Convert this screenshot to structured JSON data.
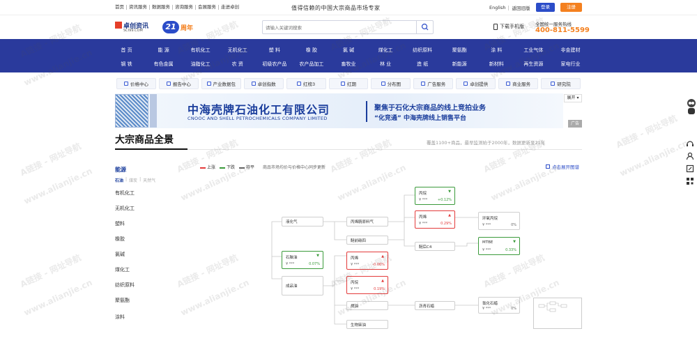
{
  "topbar": {
    "links": [
      "首页",
      "资讯服务",
      "数据服务",
      "咨询服务",
      "会展服务",
      "走进卓创"
    ],
    "slogan": "值得信赖的中国大宗商品市场专家",
    "english": "English",
    "old_version": "返回旧版",
    "login": "登录",
    "register": "注册"
  },
  "header": {
    "logo_main": "卓创资讯",
    "logo_sub": "SCI99.COM",
    "anniv_number": "21",
    "anniv_text": "周年",
    "search_placeholder": "请输入关键词搜索",
    "mobile": "下载手机版",
    "hotline_label": "全国统一服务热线",
    "hotline_number": "400-811-5599"
  },
  "nav": {
    "row1": [
      "首 页",
      "能 源",
      "有机化工",
      "无机化工",
      "塑 料",
      "橡 胶",
      "氯 碱",
      "煤化工",
      "纺织原料",
      "聚氨酯",
      "涂 料",
      "工业气体",
      "非金建材"
    ],
    "row2": [
      "钢 铁",
      "有色金属",
      "油脂化工",
      "农 资",
      "初级农产品",
      "农产品加工",
      "畜牧业",
      "林 业",
      "造 纸",
      "新能源",
      "新材料",
      "再生资源",
      "家电行业"
    ]
  },
  "subnav": [
    "价格中心",
    "报告中心",
    "产业数据包",
    "卓创指数",
    "红榜3",
    "红期",
    "分布图",
    "广告服务",
    "卓创提供",
    "商业服务",
    "研究院"
  ],
  "banner": {
    "company_cn": "中海壳牌石油化工有限公司",
    "company_en": "CNOOC AND SHELL PETROCHEMICALS COMPANY LIMITED",
    "line1": "聚焦于石化大宗商品的线上竞拍业务",
    "line2": "“化竞通” 中海壳牌线上销售平台",
    "expand": "展开",
    "ad": "广告"
  },
  "section": {
    "title": "大宗商品全景",
    "coverage": "覆盖1100+商品，最早监测始于2000年，数据更新至21年"
  },
  "left_list": {
    "active": "能源",
    "subcats": [
      {
        "label": "石油",
        "active": true
      },
      {
        "label": "煤炭",
        "active": false
      },
      {
        "label": "天然气",
        "active": false
      }
    ],
    "categories": [
      "有机化工",
      "无机化工",
      "塑料",
      "橡胶",
      "氯碱",
      "煤化工",
      "纺织原料",
      "聚氨酯",
      "涂料"
    ]
  },
  "legend": {
    "up": "上涨",
    "down": "下跌",
    "flat": "持平",
    "note": "商品市场均价与价格中心同步更新",
    "expand_map": "点击展开图谱"
  },
  "colors": {
    "nav_bg": "#2a3a9c",
    "accent_orange": "#f4801f",
    "up": "#e33a3a",
    "down": "#3a9a3a",
    "flat": "#666666"
  },
  "flow_nodes": [
    {
      "id": "n1",
      "name": "液化气",
      "trend": "plain"
    },
    {
      "id": "n2",
      "name": "石脑油",
      "price": "¥ ***",
      "change": "0.07%",
      "trend": "down"
    },
    {
      "id": "n3",
      "name": "成品油",
      "trend": "plain"
    },
    {
      "id": "n4",
      "name": "丙烯腈原料气",
      "trend": "plain"
    },
    {
      "id": "n5",
      "name": "醚前碳四",
      "trend": "plain"
    },
    {
      "id": "n6",
      "name": "丙烯",
      "price": "¥ ***",
      "change": "-0.06%",
      "trend": "up"
    },
    {
      "id": "n7",
      "name": "丙烷",
      "price": "¥ ***",
      "change": "0.19%",
      "trend": "up"
    },
    {
      "id": "n8",
      "name": "燃油",
      "trend": "plain"
    },
    {
      "id": "n9",
      "name": "生物柴油",
      "trend": "plain"
    },
    {
      "id": "n10",
      "name": "丙烷",
      "price": "¥ ***",
      "change": "+0.12%",
      "trend": "down"
    },
    {
      "id": "n11",
      "name": "丙烯",
      "price": "¥ ***",
      "change": "0.29%",
      "trend": "up"
    },
    {
      "id": "n12",
      "name": "醚后C4",
      "trend": "plain"
    },
    {
      "id": "n13",
      "name": "沥青石蜡",
      "trend": "plain"
    },
    {
      "id": "n14",
      "name": "环氧丙烷",
      "price": "¥ ***",
      "change": "0%",
      "trend": "flat"
    },
    {
      "id": "n15",
      "name": "MTBE",
      "price": "¥ ***",
      "change": "0.33%",
      "trend": "down"
    },
    {
      "id": "n16",
      "name": "氯化石蜡",
      "price": "¥ ***",
      "change": "0%",
      "trend": "flat"
    }
  ],
  "watermark": {
    "cn": "A链接 - 网址导航",
    "url": "www.alianjie.cn"
  }
}
